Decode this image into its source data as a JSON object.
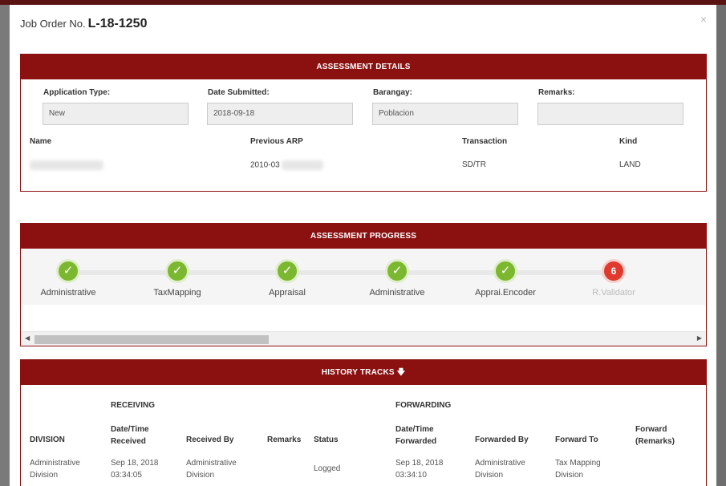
{
  "modal": {
    "title_prefix": "Job Order No.",
    "title_number": "L-18-1250",
    "close_glyph": "×"
  },
  "assessment_details": {
    "header": "ASSESSMENT DETAILS",
    "fields": [
      {
        "label": "Application Type:",
        "value": "New"
      },
      {
        "label": "Date Submitted:",
        "value": "2018-09-18"
      },
      {
        "label": "Barangay:",
        "value": "Poblacion"
      },
      {
        "label": "Remarks:",
        "value": ""
      }
    ],
    "columns": [
      "Name",
      "Previous ARP",
      "Transaction",
      "Kind"
    ],
    "row": {
      "name": "",
      "previous_arp": "2010-03",
      "transaction": "SD/TR",
      "kind": "LAND"
    }
  },
  "assessment_progress": {
    "header": "ASSESSMENT PROGRESS",
    "steps": [
      {
        "label": "Administrative",
        "mark": "✓"
      },
      {
        "label": "TaxMapping",
        "mark": "✓"
      },
      {
        "label": "Appraisal",
        "mark": "✓"
      },
      {
        "label": "Administrative",
        "mark": "✓"
      },
      {
        "label": "Apprai.Encoder",
        "mark": "✓"
      },
      {
        "label": "R.Validator",
        "mark": "6"
      }
    ],
    "colors": {
      "done": "#7cb82f",
      "current": "#e03a2f"
    }
  },
  "history_tracks": {
    "header": "HISTORY TRACKS",
    "header_icon": "arrow-down-icon",
    "group_receiving": "RECEIVING",
    "group_forwarding": "FORWARDING",
    "columns": {
      "division": "DIVISION",
      "date_received_1": "Date/Time",
      "date_received_2": "Received",
      "received_by": "Received By",
      "remarks": "Remarks",
      "status": "Status",
      "date_forwarded_1": "Date/Time",
      "date_forwarded_2": "Forwarded",
      "forwarded_by": "Forwarded By",
      "forward_to": "Forward To",
      "forward_remarks_1": "Forward",
      "forward_remarks_2": "(Remarks)"
    },
    "row": {
      "division_1": "Administrative",
      "division_2": "Division",
      "received_date": "Sep 18, 2018",
      "received_time": "03:34:05",
      "received_by_1": "Administrative",
      "received_by_2": "Division",
      "status": "Logged",
      "forwarded_date": "Sep 18, 2018",
      "forwarded_time": "03:34:10",
      "forwarded_by_1": "Administrative",
      "forwarded_by_2": "Division",
      "forward_to_1": "Tax Mapping",
      "forward_to_2": "Division"
    }
  },
  "theme": {
    "accent": "#8b1010"
  }
}
